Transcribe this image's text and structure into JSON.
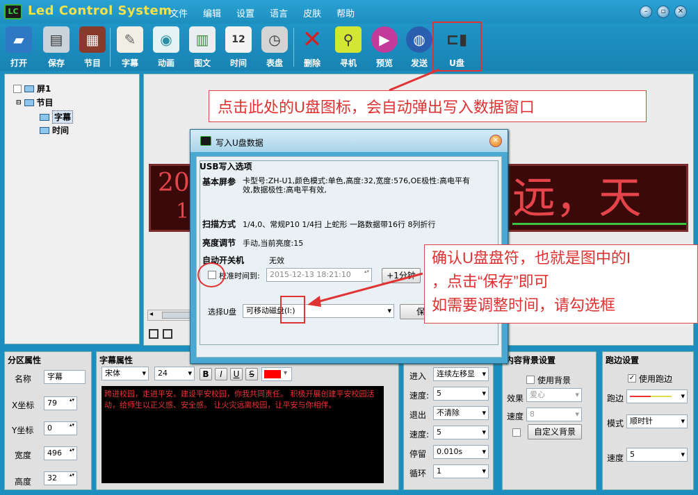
{
  "app": {
    "logo_text": "LC",
    "title": "Led Control System"
  },
  "menu": [
    "文件",
    "编辑",
    "设置",
    "语言",
    "皮肤",
    "帮助"
  ],
  "toolbar": [
    "打开",
    "保存",
    "节目",
    "字幕",
    "动画",
    "图文",
    "时间",
    "表盘",
    "删除",
    "寻机",
    "预览",
    "发送",
    "U盘"
  ],
  "tree": {
    "screen": "屏1",
    "program": "节目",
    "items": [
      "字幕",
      "时间"
    ]
  },
  "led_preview": {
    "left_text": "20",
    "left_text2": "1",
    "right_text": "远，天"
  },
  "callouts": {
    "top": "点击此处的U盘图标，会自动弹出写入数据窗口",
    "right_line1": "确认U盘盘符，也就是图中的I",
    "right_line2": "，点击“保存”即可",
    "right_line3": "如需要调整时间，请勾选框"
  },
  "dialog": {
    "title": "写入U盘数据",
    "section": "USB写入选项",
    "basic_label": "基本屏参",
    "basic_value": "卡型号:ZH-U1,颜色模式:单色,高度:32,宽度:576,OE极性:高电平有效,数据极性:高电平有效,",
    "scan_label": "扫描方式",
    "scan_value": "1/4,0、常规P10  1/4扫 上蛇形 一路数据带16行 8列折行",
    "bright_label": "亮度调节",
    "bright_value": "手动,当前亮度:15",
    "auto_label": "自动开关机",
    "auto_value": "无效",
    "calib_label": "校准时间到:",
    "calib_value": "2015-12-13   18:21:10",
    "plus_button": "+1分钟",
    "udisk_label": "选择U盘",
    "udisk_value": "可移动磁盘(I:)",
    "save_button": "保存"
  },
  "area_props": {
    "title": "分区属性",
    "name_label": "名称",
    "name_value": "字幕",
    "x_label": "X坐标",
    "x_value": "79",
    "y_label": "Y坐标",
    "y_value": "0",
    "w_label": "宽度",
    "w_value": "496",
    "h_label": "高度",
    "h_value": "32"
  },
  "caption_props": {
    "title": "字幕属性",
    "font": "宋体",
    "size": "24",
    "bold": "B",
    "italic": "I",
    "underline": "U",
    "strike": "S",
    "text": "跨进校园，走进平安。建设平安校园，你我共同责任。        积极开展创建平安校园活动，给师生以正义感、安全感。           让火灾远离校园，让平安与你相伴。"
  },
  "effects": {
    "enter_label": "进入",
    "enter_value": "连续左移显",
    "speed1_label": "速度:",
    "speed1_value": "5",
    "exit_label": "退出",
    "exit_value": "不清除",
    "speed2_label": "速度:",
    "speed2_value": "5",
    "stay_label": "停留",
    "stay_value": "0.010s",
    "loop_label": "循环",
    "loop_value": "1"
  },
  "bg_props": {
    "title": "内容背景设置",
    "use_bg": "使用背景",
    "effect_label": "效果",
    "effect_value": "爱心",
    "speed_label": "速度",
    "speed_value": "8",
    "custom_button": "自定义背景"
  },
  "border_props": {
    "title": "跑边设置",
    "use_border": "使用跑边",
    "border_label": "跑边",
    "mode_label": "模式",
    "mode_value": "顺时针",
    "speed_label": "速度",
    "speed_value": "5"
  },
  "colors": {
    "accent": "#1d8fbf",
    "highlight": "#e03434",
    "title_text": "#f3e24a"
  }
}
